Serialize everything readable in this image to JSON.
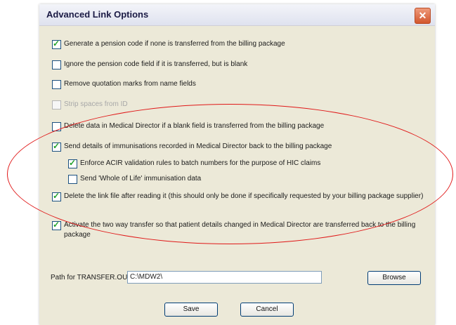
{
  "window": {
    "title": "Advanced Link Options",
    "close_glyph": "✕"
  },
  "options": [
    {
      "label": "Generate a pension code if none is transferred from the billing package",
      "checked": true,
      "disabled": false
    },
    {
      "label": "Ignore the pension code field if it is transferred, but is blank",
      "checked": false,
      "disabled": false
    },
    {
      "label": "Remove quotation marks from name fields",
      "checked": false,
      "disabled": false
    },
    {
      "label": "Strip spaces from ID",
      "checked": false,
      "disabled": true
    },
    {
      "label": "Delete data in Medical Director if a blank field is transferred from the billing package",
      "checked": false,
      "disabled": false
    },
    {
      "label": "Send details of immunisations recorded in Medical Director back to the billing package",
      "checked": true,
      "disabled": false
    },
    {
      "label": "Enforce ACIR validation rules to batch numbers for the purpose of HIC claims",
      "checked": true,
      "disabled": false
    },
    {
      "label": "Send 'Whole of Life' immunisation data",
      "checked": false,
      "disabled": false
    },
    {
      "label": "Delete the link file after reading it (this should only be done if specifically requested by your billing package supplier)",
      "checked": true,
      "disabled": false
    },
    {
      "label": "Activate the two way transfer so that patient details changed in Medical Director are transferred back to the billing package",
      "checked": true,
      "disabled": false
    }
  ],
  "path": {
    "label": "Path for TRANSFER.OUT file:",
    "value": "C:\\MDW2\\"
  },
  "buttons": {
    "browse": "Browse",
    "save": "Save",
    "cancel": "Cancel"
  },
  "colors": {
    "annotation": "#e01818",
    "accent": "#003c74",
    "check": "#22a22a"
  }
}
